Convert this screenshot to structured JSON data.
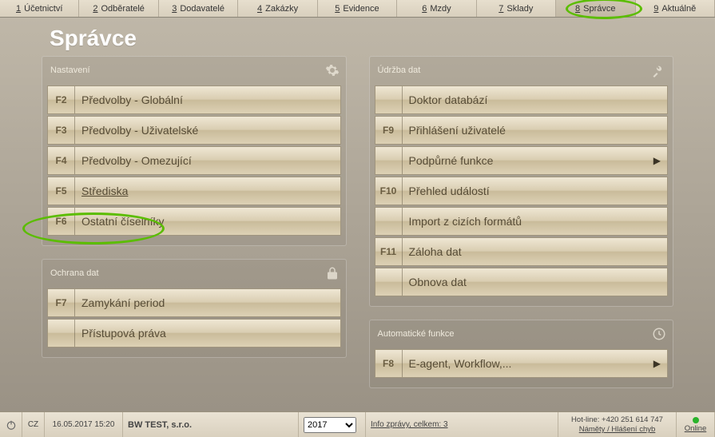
{
  "menu": [
    {
      "num": "1",
      "label": "Účetnictví"
    },
    {
      "num": "2",
      "label": "Odběratelé"
    },
    {
      "num": "3",
      "label": "Dodavatelé"
    },
    {
      "num": "4",
      "label": "Zakázky"
    },
    {
      "num": "5",
      "label": "Evidence"
    },
    {
      "num": "6",
      "label": "Mzdy"
    },
    {
      "num": "7",
      "label": "Sklady"
    },
    {
      "num": "8",
      "label": "Správce"
    },
    {
      "num": "9",
      "label": "Aktuálně"
    }
  ],
  "page_title": "Správce",
  "panels": {
    "nastaveni": {
      "title": "Nastavení",
      "items": [
        {
          "fkey": "F2",
          "label": "Předvolby - Globální"
        },
        {
          "fkey": "F3",
          "label": "Předvolby - Uživatelské"
        },
        {
          "fkey": "F4",
          "label": "Předvolby - Omezující"
        },
        {
          "fkey": "F5",
          "label": "Střediska"
        },
        {
          "fkey": "F6",
          "label": "Ostatní číselníky"
        }
      ]
    },
    "ochrana": {
      "title": "Ochrana dat",
      "items": [
        {
          "fkey": "F7",
          "label": "Zamykání period"
        },
        {
          "fkey": "",
          "label": "Přístupová práva"
        }
      ]
    },
    "udrzba": {
      "title": "Údržba dat",
      "items": [
        {
          "fkey": "",
          "label": "Doktor databází"
        },
        {
          "fkey": "F9",
          "label": "Přihlášení uživatelé"
        },
        {
          "fkey": "",
          "label": "Podpůrné funkce",
          "submenu": true
        },
        {
          "fkey": "F10",
          "label": "Přehled událostí"
        },
        {
          "fkey": "",
          "label": "Import z cizích formátů"
        },
        {
          "fkey": "F11",
          "label": "Záloha dat"
        },
        {
          "fkey": "",
          "label": "Obnova dat"
        }
      ]
    },
    "auto": {
      "title": "Automatické funkce",
      "items": [
        {
          "fkey": "F8",
          "label": "E-agent, Workflow,...",
          "submenu": true
        }
      ]
    }
  },
  "status": {
    "lang": "CZ",
    "datetime": "16.05.2017 15:20",
    "company": "BW TEST, s.r.o.",
    "year": "2017",
    "info": "Info zprávy, celkem: 3",
    "hotline": "Hot-line: +420 251 614 747",
    "feedback": "Náměty / Hlášení chyb",
    "connection": "Online"
  }
}
